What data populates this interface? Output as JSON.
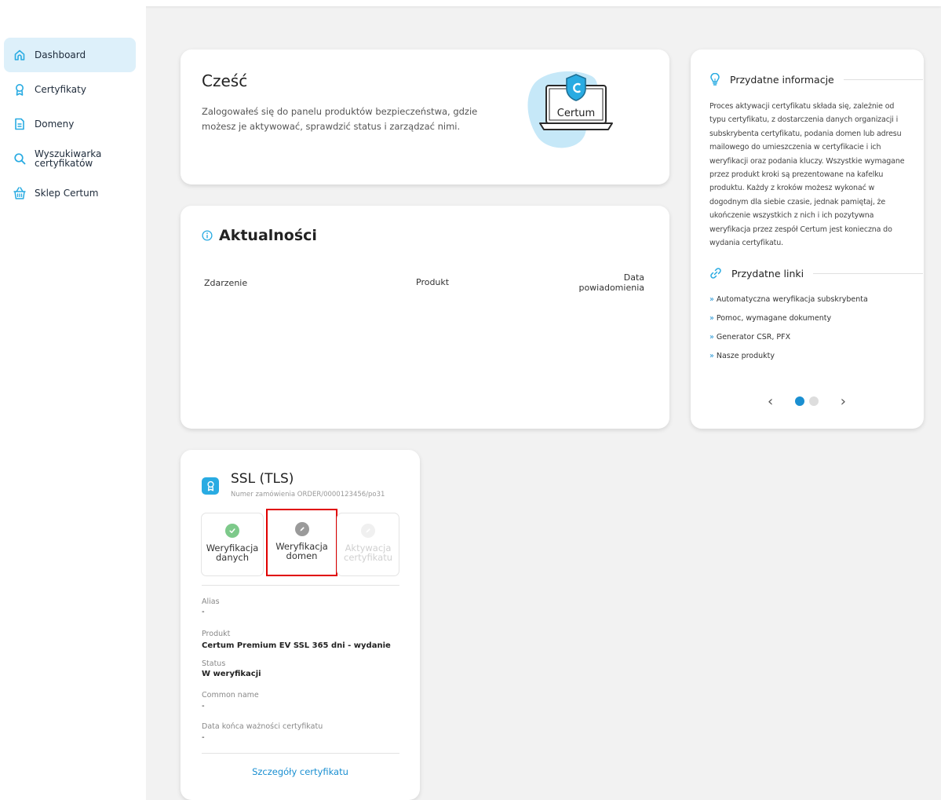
{
  "colors": {
    "accent": "#29abe2",
    "link": "#1a8fd1",
    "active_nav_bg": "#ddf0fa",
    "highlight": "#e00000"
  },
  "sidebar": {
    "items": [
      {
        "label": "Dashboard",
        "icon": "home-icon",
        "active": true
      },
      {
        "label": "Certyfikaty",
        "icon": "award-icon"
      },
      {
        "label": "Domeny",
        "icon": "document-icon"
      },
      {
        "label": "Wyszukiwarka\ncertyfikatów",
        "label_line1": "Wyszukiwarka",
        "label_line2": "certyfikatów",
        "icon": "search-icon"
      },
      {
        "label": "Sklep Certum",
        "icon": "basket-icon"
      }
    ]
  },
  "welcome": {
    "title": "Cześć",
    "text": "Zalogowałeś się do panelu produktów bezpieczeństwa, gdzie możesz je aktywować, sprawdzić status i zarządzać nimi.",
    "logo_text": "Certum"
  },
  "news": {
    "title": "Aktualności",
    "columns": {
      "event": "Zdarzenie",
      "product": "Produkt",
      "date_line1": "Data",
      "date_line2": "powiadomienia"
    }
  },
  "info": {
    "title": "Przydatne informacje",
    "text": "Proces aktywacji certyfikatu składa się, zależnie od typu certyfikatu, z dostarczenia danych organizacji i subskrybenta certyfikatu, podania domen lub adresu mailowego do umieszczenia w certyfikacie i ich weryfikacji oraz podania kluczy. Wszystkie wymagane przez produkt kroki są prezentowane na kafelku produktu. Każdy z kroków możesz wykonać w dogodnym dla siebie czasie, jednak pamiętaj, że ukończenie wszystkich z nich i ich pozytywna weryfikacja przez zespół Certum jest konieczna do wydania certyfikatu.",
    "links_title": "Przydatne linki",
    "links": [
      "Automatyczna weryfikacja subskrybenta",
      "Pomoc, wymagane dokumenty",
      "Generator CSR, PFX",
      "Nasze produkty"
    ],
    "link_marker": "»",
    "carousel": {
      "prev": "‹",
      "next": "›",
      "active_page": 1,
      "pages": 2
    }
  },
  "product": {
    "title": "SSL (TLS)",
    "order": "Numer zamówienia ORDER/0000123456/po31",
    "steps": [
      {
        "line1": "Weryfikacja",
        "line2": "danych",
        "state": "done"
      },
      {
        "line1": "Weryfikacja",
        "line2": "domen",
        "state": "in-progress"
      },
      {
        "line1": "Aktywacja",
        "line2": "certyfikatu",
        "state": "disabled"
      }
    ],
    "fields": {
      "alias_label": "Alias",
      "alias_value": "-",
      "product_label": "Produkt",
      "product_value": "Certum Premium EV SSL 365 dni - wydanie",
      "status_label": "Status",
      "status_value": "W weryfikacji",
      "cn_label": "Common name",
      "cn_value": "-",
      "expiry_label": "Data końca ważności certyfikatu",
      "expiry_value": "-"
    },
    "details_link": "Szczegóły certyfikatu"
  }
}
